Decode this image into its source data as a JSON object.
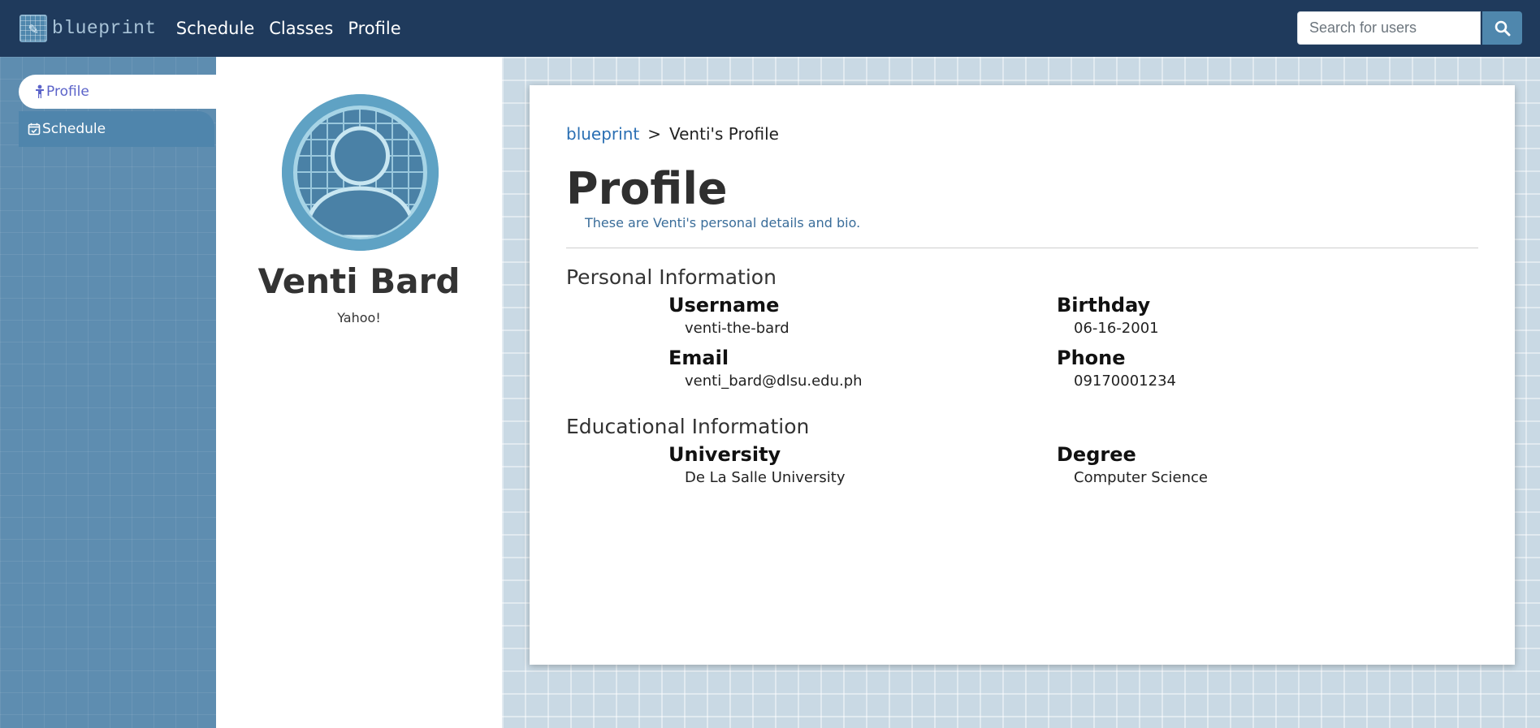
{
  "navbar": {
    "brand": "blueprint",
    "links": [
      "Schedule",
      "Classes",
      "Profile"
    ],
    "search_placeholder": "Search for users"
  },
  "sidebar": {
    "items": [
      {
        "label": "Profile",
        "icon": "person-icon",
        "active": true
      },
      {
        "label": "Schedule",
        "icon": "calendar-check-icon",
        "active": false
      }
    ]
  },
  "profile": {
    "name": "Venti Bard",
    "bio": "Yahoo!"
  },
  "main": {
    "breadcrumb": {
      "home": "blueprint",
      "separator": ">",
      "current": "Venti's Profile"
    },
    "title": "Profile",
    "subtitle": "These are Venti's personal details and bio.",
    "personal": {
      "heading": "Personal Information",
      "username_label": "Username",
      "username": "venti-the-bard",
      "birthday_label": "Birthday",
      "birthday": "06-16-2001",
      "email_label": "Email",
      "email": "venti_bard@dlsu.edu.ph",
      "phone_label": "Phone",
      "phone": "09170001234"
    },
    "education": {
      "heading": "Educational Information",
      "university_label": "University",
      "university": "De La Salle University",
      "degree_label": "Degree",
      "degree": "Computer Science"
    }
  },
  "colors": {
    "navbar": "#1f3a5c",
    "accent": "#4f87ad",
    "link": "#2a6fb3",
    "sidebar_active_text": "#5b63c9"
  }
}
